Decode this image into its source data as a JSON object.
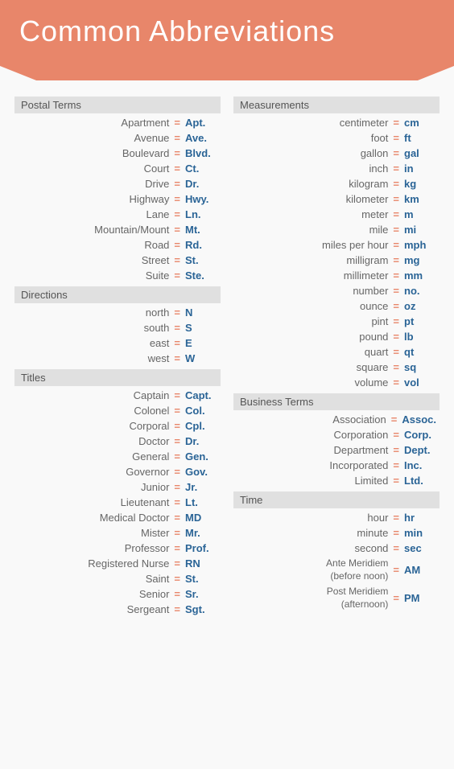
{
  "header": {
    "title": "Common Abbreviations"
  },
  "left_column": {
    "sections": [
      {
        "id": "postal",
        "header": "Postal Terms",
        "rows": [
          {
            "term": "Apartment",
            "abbr": "Apt."
          },
          {
            "term": "Avenue",
            "abbr": "Ave."
          },
          {
            "term": "Boulevard",
            "abbr": "Blvd."
          },
          {
            "term": "Court",
            "abbr": "Ct."
          },
          {
            "term": "Drive",
            "abbr": "Dr."
          },
          {
            "term": "Highway",
            "abbr": "Hwy."
          },
          {
            "term": "Lane",
            "abbr": "Ln."
          },
          {
            "term": "Mountain/Mount",
            "abbr": "Mt."
          },
          {
            "term": "Road",
            "abbr": "Rd."
          },
          {
            "term": "Street",
            "abbr": "St."
          },
          {
            "term": "Suite",
            "abbr": "Ste."
          }
        ]
      },
      {
        "id": "directions",
        "header": "Directions",
        "rows": [
          {
            "term": "north",
            "abbr": "N"
          },
          {
            "term": "south",
            "abbr": "S"
          },
          {
            "term": "east",
            "abbr": "E"
          },
          {
            "term": "west",
            "abbr": "W"
          }
        ]
      },
      {
        "id": "titles",
        "header": "Titles",
        "rows": [
          {
            "term": "Captain",
            "abbr": "Capt."
          },
          {
            "term": "Colonel",
            "abbr": "Col."
          },
          {
            "term": "Corporal",
            "abbr": "Cpl."
          },
          {
            "term": "Doctor",
            "abbr": "Dr."
          },
          {
            "term": "General",
            "abbr": "Gen."
          },
          {
            "term": "Governor",
            "abbr": "Gov."
          },
          {
            "term": "Junior",
            "abbr": "Jr."
          },
          {
            "term": "Lieutenant",
            "abbr": "Lt."
          },
          {
            "term": "Medical Doctor",
            "abbr": "MD"
          },
          {
            "term": "Mister",
            "abbr": "Mr."
          },
          {
            "term": "Professor",
            "abbr": "Prof."
          },
          {
            "term": "Registered Nurse",
            "abbr": "RN"
          },
          {
            "term": "Saint",
            "abbr": "St."
          },
          {
            "term": "Senior",
            "abbr": "Sr."
          },
          {
            "term": "Sergeant",
            "abbr": "Sgt."
          }
        ]
      }
    ]
  },
  "right_column": {
    "sections": [
      {
        "id": "measurements",
        "header": "Measurements",
        "rows": [
          {
            "term": "centimeter",
            "abbr": "cm"
          },
          {
            "term": "foot",
            "abbr": "ft"
          },
          {
            "term": "gallon",
            "abbr": "gal"
          },
          {
            "term": "inch",
            "abbr": "in"
          },
          {
            "term": "kilogram",
            "abbr": "kg"
          },
          {
            "term": "kilometer",
            "abbr": "km"
          },
          {
            "term": "meter",
            "abbr": "m"
          },
          {
            "term": "mile",
            "abbr": "mi"
          },
          {
            "term": "miles per hour",
            "abbr": "mph"
          },
          {
            "term": "milligram",
            "abbr": "mg"
          },
          {
            "term": "millimeter",
            "abbr": "mm"
          },
          {
            "term": "number",
            "abbr": "no."
          },
          {
            "term": "ounce",
            "abbr": "oz"
          },
          {
            "term": "pint",
            "abbr": "pt"
          },
          {
            "term": "pound",
            "abbr": "lb"
          },
          {
            "term": "quart",
            "abbr": "qt"
          },
          {
            "term": "square",
            "abbr": "sq"
          },
          {
            "term": "volume",
            "abbr": "vol"
          }
        ]
      },
      {
        "id": "business",
        "header": "Business Terms",
        "rows": [
          {
            "term": "Association",
            "abbr": "Assoc."
          },
          {
            "term": "Corporation",
            "abbr": "Corp."
          },
          {
            "term": "Department",
            "abbr": "Dept."
          },
          {
            "term": "Incorporated",
            "abbr": "Inc."
          },
          {
            "term": "Limited",
            "abbr": "Ltd."
          }
        ]
      },
      {
        "id": "time",
        "header": "Time",
        "rows": [
          {
            "term": "hour",
            "abbr": "hr"
          },
          {
            "term": "minute",
            "abbr": "min"
          },
          {
            "term": "second",
            "abbr": "sec"
          },
          {
            "term": "Ante Meridiem\n(before noon)",
            "abbr": "AM",
            "multiline": true
          },
          {
            "term": "Post Meridiem\n(afternoon)",
            "abbr": "PM",
            "multiline": true
          }
        ]
      }
    ]
  },
  "equals_sign": "="
}
